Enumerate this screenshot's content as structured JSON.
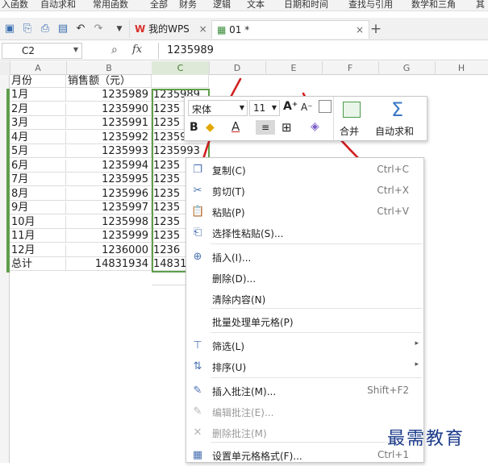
{
  "ribbon": {
    "partial_labels": [
      "入函数",
      "自动求和",
      "常用函数",
      "全部",
      "财务",
      "逻辑",
      "文本",
      "日期和时间",
      "查找与引用",
      "数学和三角",
      "其"
    ]
  },
  "tabs": [
    {
      "label": "我的WPS"
    },
    {
      "label": "01 *"
    }
  ],
  "formula_bar": {
    "cell_ref": "C2",
    "fx": "fx",
    "value": "1235989"
  },
  "columns": [
    "A",
    "B",
    "C",
    "D",
    "E",
    "F",
    "G",
    "H"
  ],
  "headers": {
    "month": "月份",
    "sales": "销售额（元）"
  },
  "rows": [
    {
      "month": "1月",
      "sales": "1235989",
      "c": "1235989"
    },
    {
      "month": "2月",
      "sales": "1235990",
      "c": "1235"
    },
    {
      "month": "3月",
      "sales": "1235991",
      "c": "1235"
    },
    {
      "month": "4月",
      "sales": "1235992",
      "c": "1235992"
    },
    {
      "month": "5月",
      "sales": "1235993",
      "c": "1235993"
    },
    {
      "month": "6月",
      "sales": "1235994",
      "c": "1235"
    },
    {
      "month": "7月",
      "sales": "1235995",
      "c": "1235"
    },
    {
      "month": "8月",
      "sales": "1235996",
      "c": "1235"
    },
    {
      "month": "9月",
      "sales": "1235997",
      "c": "1235"
    },
    {
      "month": "10月",
      "sales": "1235998",
      "c": "1235"
    },
    {
      "month": "11月",
      "sales": "1235999",
      "c": "1235"
    },
    {
      "month": "12月",
      "sales": "1236000",
      "c": "1236"
    },
    {
      "month": "总计",
      "sales": "14831934",
      "c": "14831"
    }
  ],
  "mini_toolbar": {
    "font": "宋体",
    "size": "11",
    "grow": "A⁺",
    "shrink": "A⁻",
    "bold": "B",
    "font_color": "A",
    "merge": "合并",
    "autosum": "自动求和"
  },
  "context_menu": [
    {
      "label": "复制(C)",
      "shortcut": "Ctrl+C",
      "icon": "copy-icon"
    },
    {
      "label": "剪切(T)",
      "shortcut": "Ctrl+X",
      "icon": "scissors-icon"
    },
    {
      "label": "粘贴(P)",
      "shortcut": "Ctrl+V",
      "icon": "paste-icon"
    },
    {
      "label": "选择性粘贴(S)...",
      "shortcut": "",
      "icon": "paste-special-icon"
    },
    {
      "label": "插入(I)...",
      "shortcut": "",
      "icon": "insert-icon"
    },
    {
      "label": "删除(D)...",
      "shortcut": "",
      "icon": ""
    },
    {
      "label": "清除内容(N)",
      "shortcut": "",
      "icon": ""
    },
    {
      "label": "批量处理单元格(P)",
      "shortcut": "",
      "icon": ""
    },
    {
      "label": "筛选(L)",
      "shortcut": "",
      "icon": "filter-icon",
      "submenu": true
    },
    {
      "label": "排序(U)",
      "shortcut": "",
      "icon": "sort-icon",
      "submenu": true
    },
    {
      "label": "插入批注(M)...",
      "shortcut": "Shift+F2",
      "icon": "comment-icon"
    },
    {
      "label": "编辑批注(E)...",
      "shortcut": "",
      "icon": "edit-comment-icon",
      "disabled": true
    },
    {
      "label": "删除批注(M)",
      "shortcut": "",
      "icon": "delete-comment-icon",
      "disabled": true
    },
    {
      "label": "设置单元格格式(F)...",
      "shortcut": "Ctrl+1",
      "icon": "format-cells-icon"
    }
  ],
  "watermark": "最需教育",
  "colors": {
    "selection": "#5f9e4a",
    "annotation": "#d21f1f",
    "wps_red": "#d9302c"
  }
}
